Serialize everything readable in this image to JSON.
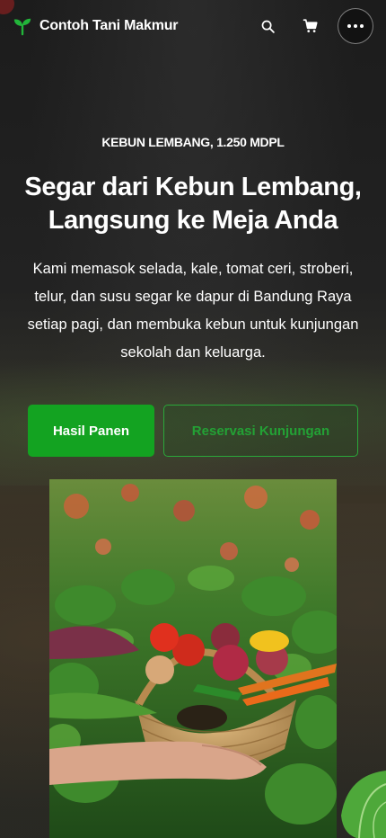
{
  "header": {
    "brand_name": "Contoh Tani Makmur",
    "brand_icon": "sprout-icon",
    "actions": {
      "search_icon": "search-icon",
      "cart_icon": "cart-icon",
      "more_icon": "more-horizontal-icon"
    }
  },
  "hero": {
    "eyebrow": "KEBUN LEMBANG, 1.250 MDPL",
    "title_line1": "Segar dari Kebun Lembang,",
    "title_line2": "Langsung ke Meja Anda",
    "subtitle": "Kami memasok selada, kale, tomat ceri, stroberi, telur, dan susu segar ke dapur di Bandung Raya setiap pagi, dan membuka kebun untuk kunjungan sekolah dan keluarga.",
    "primary_cta": "Hasil Panen",
    "secondary_cta": "Reservasi Kunjungan"
  },
  "colors": {
    "accent": "#13a321",
    "background": "#1f211d",
    "text": "#ffffff"
  }
}
